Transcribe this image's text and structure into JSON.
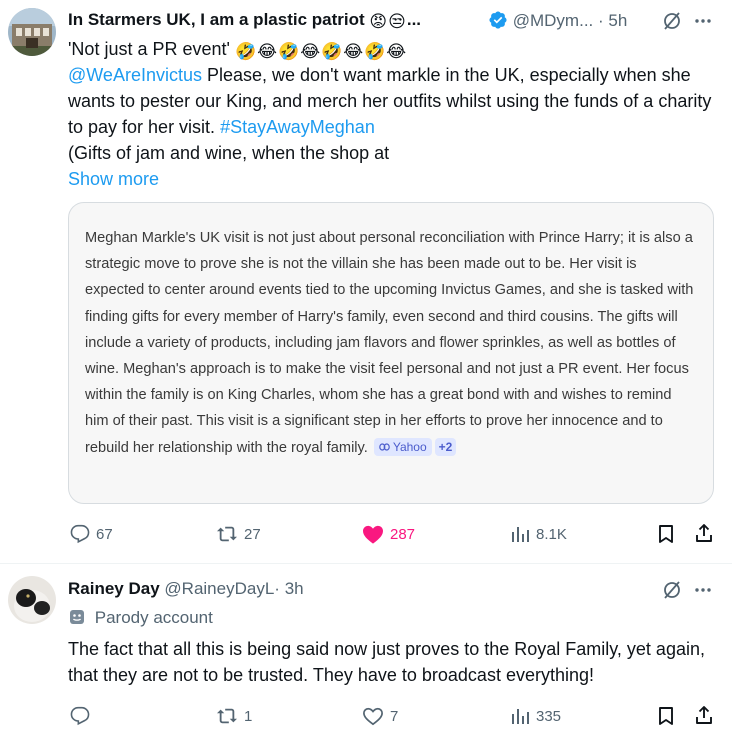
{
  "tweet1": {
    "display_name": "In Starmers UK, I am a plastic patriot",
    "name_emojis": [
      "😡",
      "😒"
    ],
    "name_ellipsis": "...",
    "handle": "@MDym...",
    "separator": "·",
    "time": "5h",
    "quote_line": "'Not just a PR event'",
    "quote_emojis": [
      "🤣",
      "😂",
      "🤣",
      "😂",
      "🤣",
      "😂",
      "🤣",
      "😂"
    ],
    "mention": "@WeAreInvictus",
    "text_part1": " Please, we don't want markle in the UK, especially when she wants to pester our King, and merch her outfits whilst using the funds of a charity to pay for her visit. ",
    "hashtag": "#StayAwayMeghan",
    "text_part2": "(Gifts of jam and wine, when the shop at",
    "show_more": "Show more",
    "card": {
      "text": "Meghan Markle's UK visit is not just about personal reconciliation with Prince Harry; it is also a strategic move to prove she is not the villain she has been made out to be. Her visit is expected to center around events tied to the upcoming Invictus Games, and she is tasked with finding gifts for every member of Harry's family, even second and third cousins. The gifts will include a variety of products, including jam flavors and flower sprinkles, as well as bottles of wine. Meghan's approach is to make the visit feel personal and not just a PR event. Her focus within the family is on King Charles, whom she has a great bond with and wishes to remind him of their past. This visit is a significant step in her efforts to prove her innocence and to rebuild her relationship with the royal family.",
      "source_label": "Yahoo",
      "source_more": "+2"
    },
    "actions": {
      "replies": "67",
      "reposts": "27",
      "likes": "287",
      "views": "8.1K"
    },
    "colors": {
      "like": "#f91880",
      "verified": "#1d9bf0",
      "link": "#1d9bf0"
    }
  },
  "tweet2": {
    "display_name": "Rainey Day",
    "handle": "@RaineyDayL",
    "separator": "·",
    "time": "3h",
    "badge": "Parody account",
    "text": "The fact that all this is being said now just proves to the Royal Family, yet again, that they are not to be trusted.  They have to broadcast everything!",
    "actions": {
      "replies": "",
      "reposts": "1",
      "likes": "7",
      "views": "335"
    }
  }
}
